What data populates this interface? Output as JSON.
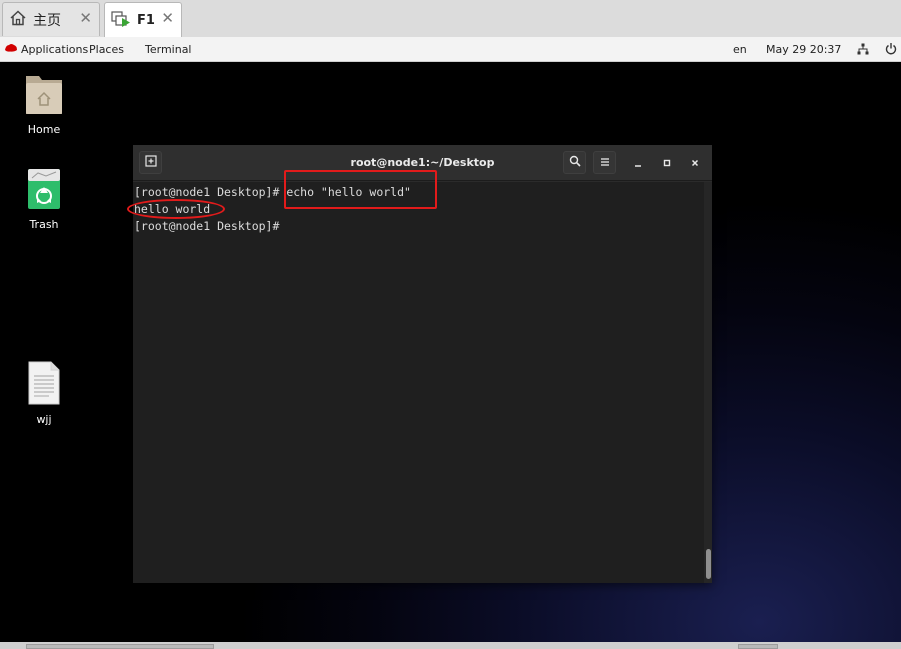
{
  "tabs": [
    {
      "label": "主页",
      "icon": "home-icon"
    },
    {
      "label": "F1",
      "icon": "vm-icon"
    }
  ],
  "topbar": {
    "applications": "Applications",
    "places": "Places",
    "terminal": "Terminal",
    "language": "en",
    "datetime": "May 29  20:37"
  },
  "desktop": {
    "icons": [
      {
        "label": "Home",
        "icon": "folder-home-icon"
      },
      {
        "label": "Trash",
        "icon": "trash-icon"
      },
      {
        "label": "wjj",
        "icon": "text-file-icon"
      }
    ]
  },
  "terminal": {
    "title": "root@node1:~/Desktop",
    "lines": [
      "[root@node1 Desktop]# echo \"hello world\"",
      "hello world",
      "[root@node1 Desktop]#"
    ]
  },
  "colors": {
    "annotation": "#e21b1b",
    "terminal_bg": "#1f1f1f",
    "trash_green": "#2ebd6b"
  }
}
